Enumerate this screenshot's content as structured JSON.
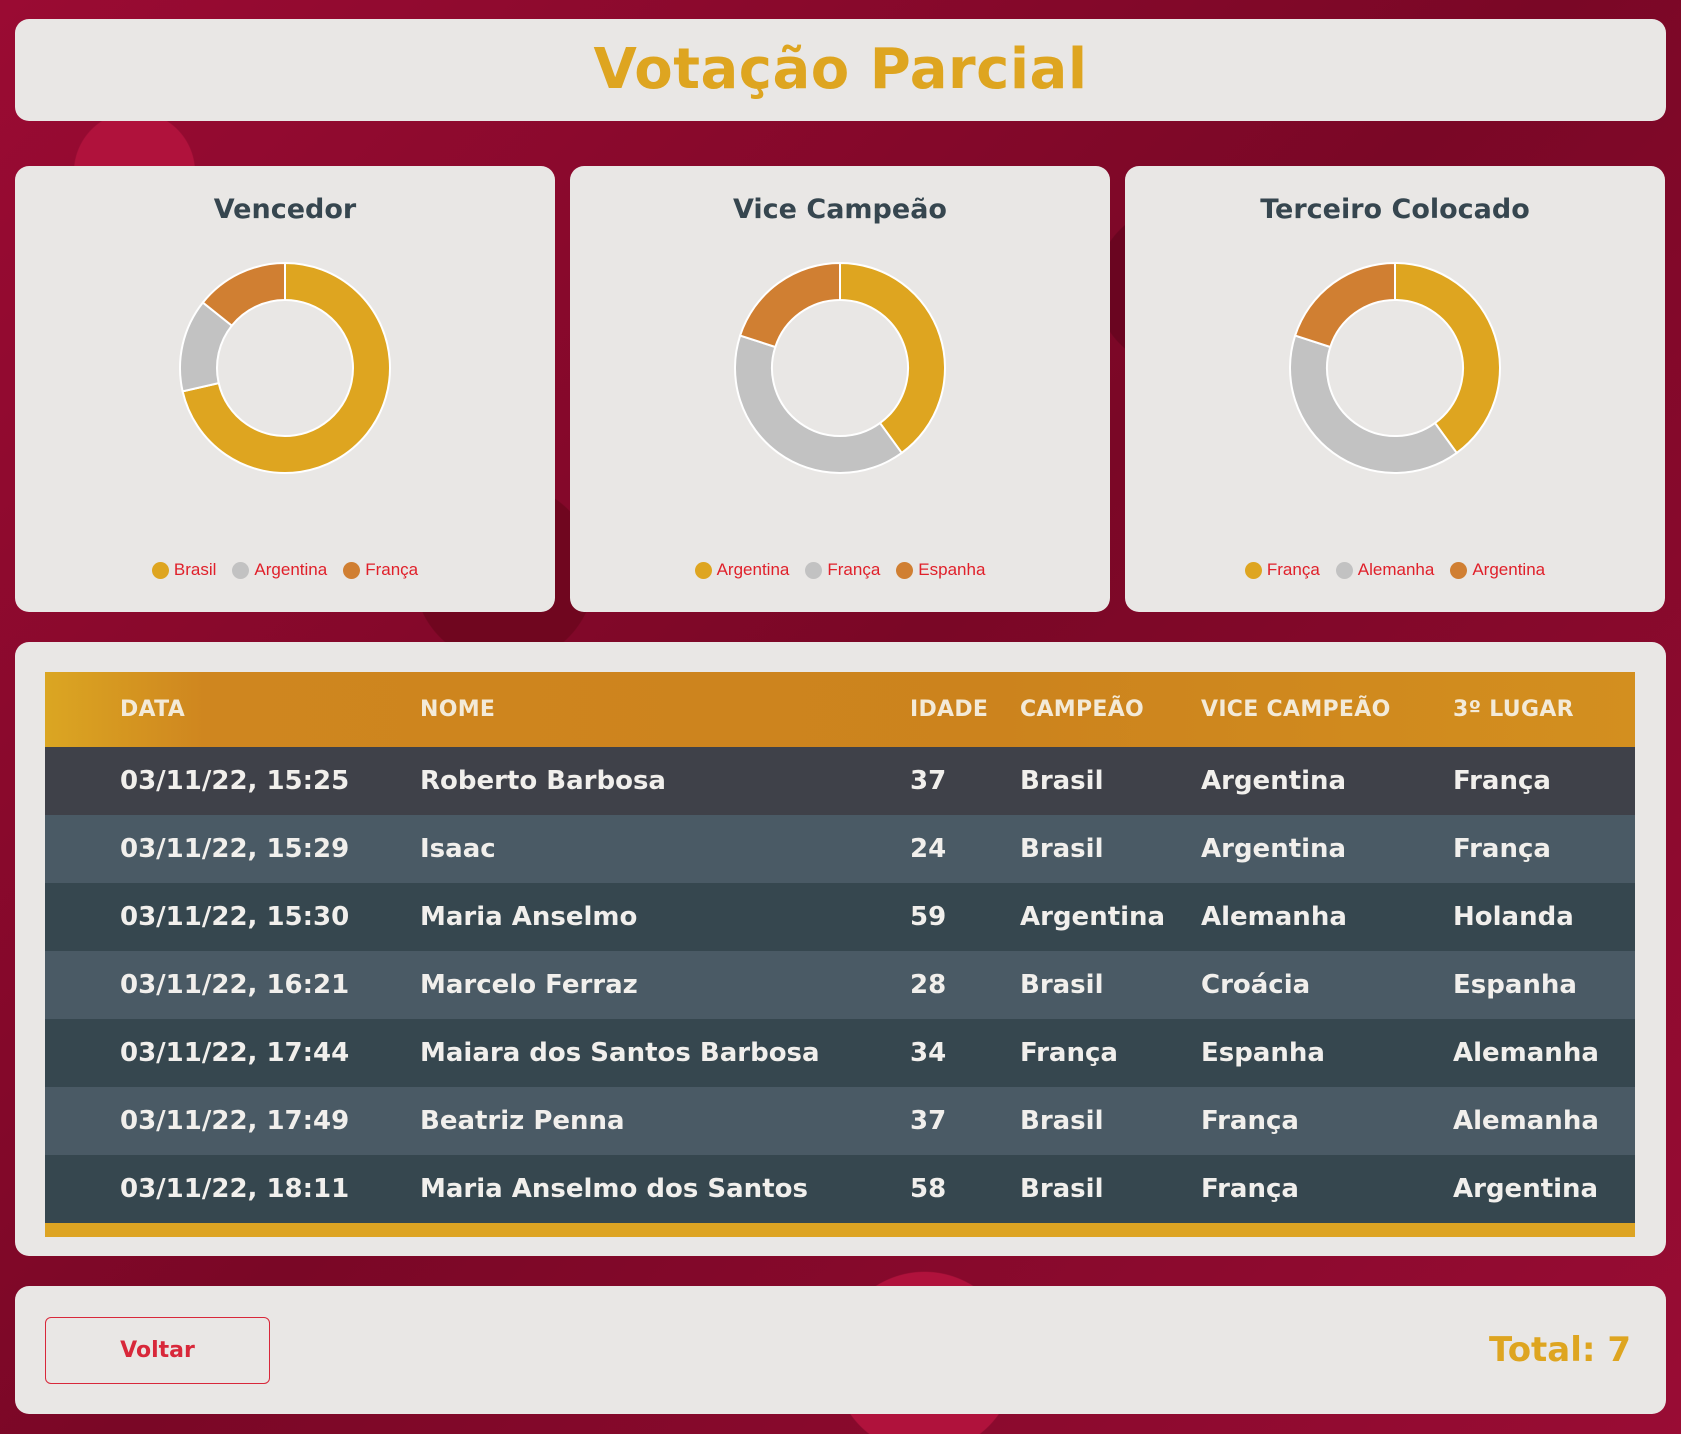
{
  "page": {
    "title": "Votação Parcial"
  },
  "colors": {
    "gold": "#dea520",
    "silver": "#c2c2c2",
    "bronze": "#d07f32",
    "legend_text": "#e0202a"
  },
  "charts": [
    {
      "title": "Vencedor",
      "legend": [
        "Brasil",
        "Argentina",
        "França"
      ],
      "chart_data": {
        "type": "pie",
        "categories": [
          "Brasil",
          "Argentina",
          "França"
        ],
        "values": [
          5,
          1,
          1
        ]
      }
    },
    {
      "title": "Vice Campeão",
      "legend": [
        "Argentina",
        "França",
        "Espanha"
      ],
      "chart_data": {
        "type": "pie",
        "categories": [
          "Argentina",
          "França",
          "Espanha"
        ],
        "values": [
          2,
          2,
          1
        ]
      }
    },
    {
      "title": "Terceiro Colocado",
      "legend": [
        "França",
        "Alemanha",
        "Argentina"
      ],
      "chart_data": {
        "type": "pie",
        "categories": [
          "França",
          "Alemanha",
          "Argentina"
        ],
        "values": [
          2,
          2,
          1
        ]
      }
    }
  ],
  "table": {
    "headers": [
      "DATA",
      "NOME",
      "IDADE",
      "CAMPEÃO",
      "VICE CAMPEÃO",
      "3º LUGAR"
    ],
    "rows": [
      [
        "03/11/22, 15:25",
        "Roberto Barbosa",
        "37",
        "Brasil",
        "Argentina",
        "França"
      ],
      [
        "03/11/22, 15:29",
        "Isaac",
        "24",
        "Brasil",
        "Argentina",
        "França"
      ],
      [
        "03/11/22, 15:30",
        "Maria Anselmo",
        "59",
        "Argentina",
        "Alemanha",
        "Holanda"
      ],
      [
        "03/11/22, 16:21",
        "Marcelo Ferraz",
        "28",
        "Brasil",
        "Croácia",
        "Espanha"
      ],
      [
        "03/11/22, 17:44",
        "Maiara dos Santos Barbosa",
        "34",
        "França",
        "Espanha",
        "Alemanha"
      ],
      [
        "03/11/22, 17:49",
        "Beatriz Penna",
        "37",
        "Brasil",
        "França",
        "Alemanha"
      ],
      [
        "03/11/22, 18:11",
        "Maria Anselmo dos Santos",
        "58",
        "Brasil",
        "França",
        "Argentina"
      ]
    ]
  },
  "footer": {
    "back_label": "Voltar",
    "total_label": "Total: 7"
  }
}
